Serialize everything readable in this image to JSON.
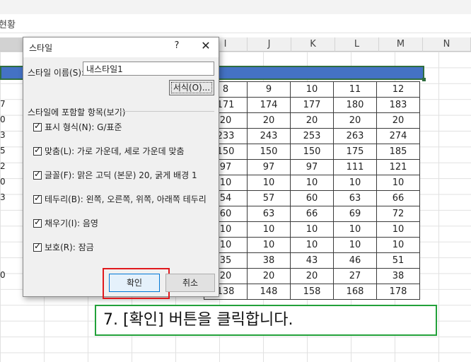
{
  "sheet": {
    "title_fragment": "현황",
    "columns": [
      "",
      "I",
      "J",
      "K",
      "L",
      "M",
      "N"
    ],
    "left_partial_values": [
      "7",
      "0",
      "3",
      "5",
      "2",
      "0",
      "3",
      "",
      "",
      "",
      "",
      "0"
    ],
    "table_rows": [
      [
        "8",
        "9",
        "10",
        "11",
        "12"
      ],
      [
        "171",
        "174",
        "177",
        "180",
        "183"
      ],
      [
        "20",
        "20",
        "20",
        "20",
        "20"
      ],
      [
        "233",
        "243",
        "253",
        "263",
        "274"
      ],
      [
        "150",
        "150",
        "150",
        "175",
        "185"
      ],
      [
        "97",
        "97",
        "97",
        "111",
        "121"
      ],
      [
        "10",
        "10",
        "10",
        "10",
        "10"
      ],
      [
        "54",
        "57",
        "60",
        "63",
        "66"
      ],
      [
        "60",
        "63",
        "66",
        "69",
        "72"
      ],
      [
        "10",
        "10",
        "10",
        "10",
        "10"
      ],
      [
        "10",
        "10",
        "10",
        "10",
        "10"
      ],
      [
        "35",
        "38",
        "43",
        "46",
        "51"
      ],
      [
        "20",
        "20",
        "20",
        "27",
        "38"
      ],
      [
        "138",
        "148",
        "158",
        "168",
        "178"
      ]
    ]
  },
  "dialog": {
    "title": "스타일",
    "help": "?",
    "close": "✕",
    "style_name_label": "스타일 이름(S):",
    "style_name_value": "내스타일1",
    "format_button": "서식(O)...",
    "group_label": "스타일에 포함할 항목(보기)",
    "options": [
      {
        "label": "표시 형식(N): G/표준",
        "checked": true
      },
      {
        "label": "맞춤(L): 가로 가운데, 세로 가운데 맞춤",
        "checked": true
      },
      {
        "label": "글꼴(F): 맑은 고딕 (본문) 20, 굵게 배경 1",
        "checked": true
      },
      {
        "label": "테두리(B): 왼쪽, 오른쪽, 위쪽, 아래쪽 테두리",
        "checked": true
      },
      {
        "label": "채우기(I): 음영",
        "checked": true
      },
      {
        "label": "보호(R): 잠금",
        "checked": true
      }
    ],
    "ok_button": "확인",
    "cancel_button": "취소"
  },
  "instruction": "7. [확인] 버튼을 클릭합니다.",
  "colors": {
    "selection_fill": "#4472c4",
    "highlight_red": "#e0191d",
    "instruction_green": "#22a13a"
  }
}
